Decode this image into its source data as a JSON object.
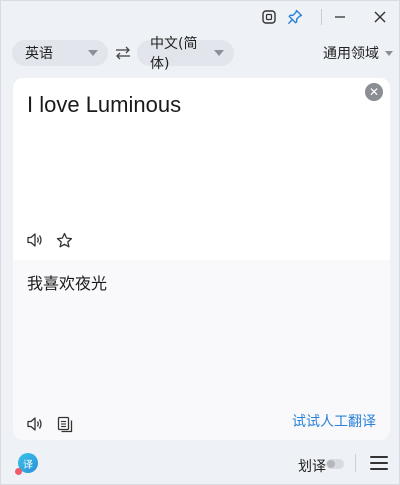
{
  "source_language": "英语",
  "target_language": "中文(简体)",
  "domain_label": "通用领域",
  "source_text": "I love Luminous",
  "translation": "我喜欢夜光",
  "human_translate_link": "试试人工翻译",
  "word_select_label": "划译",
  "app_logo_glyph": "译",
  "colors": {
    "accent_link": "#2a82d8",
    "window_bg": "#eef1f6"
  },
  "icons": {
    "screenshot": "screenshot-translate-icon",
    "pin": "pin-icon",
    "minimize": "minimize-icon",
    "close": "close-icon",
    "swap": "swap-icon",
    "speaker": "speaker-icon",
    "star": "star-icon",
    "copy": "copy-icon",
    "menu": "hamburger-menu-icon"
  },
  "word_select_enabled": false
}
